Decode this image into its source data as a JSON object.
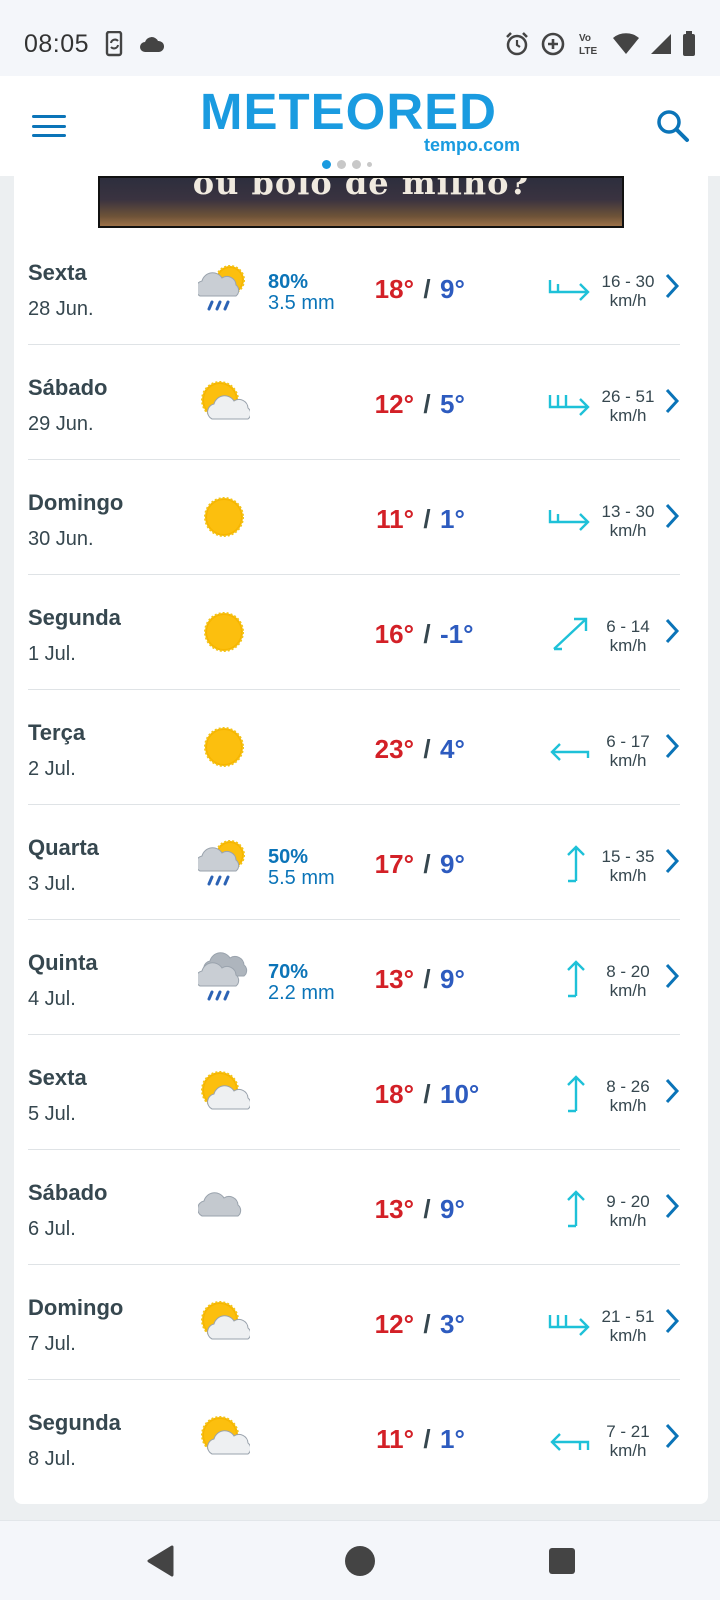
{
  "status_bar": {
    "time": "08:05",
    "icons": [
      "phone-sync-icon",
      "cloud-icon",
      "alarm-icon",
      "data-saver-icon",
      "volte-icon",
      "wifi-icon",
      "signal-icon",
      "battery-icon"
    ],
    "volte_label": "Vo LTE"
  },
  "header": {
    "logo_main": "METEORED",
    "logo_sub": "tempo.com"
  },
  "banner": {
    "text": "ou bolo de milho?"
  },
  "forecast": [
    {
      "day": "Sexta",
      "date": "28 Jun.",
      "icon": "rain-sun-icon",
      "rain_prob": "80%",
      "rain_mm": "3.5 mm",
      "tmax": "18°",
      "tmin": "9°",
      "wind": "16 - 30",
      "wind_unit": "km/h",
      "wind_dir": "east-gusty-icon"
    },
    {
      "day": "Sábado",
      "date": "29 Jun.",
      "icon": "sun-cloud-icon",
      "rain_prob": "",
      "rain_mm": "",
      "tmax": "12°",
      "tmin": "5°",
      "wind": "26 - 51",
      "wind_unit": "km/h",
      "wind_dir": "east-strong-icon"
    },
    {
      "day": "Domingo",
      "date": "30 Jun.",
      "icon": "sun-icon",
      "rain_prob": "",
      "rain_mm": "",
      "tmax": "11°",
      "tmin": "1°",
      "wind": "13 - 30",
      "wind_unit": "km/h",
      "wind_dir": "east-gusty-icon"
    },
    {
      "day": "Segunda",
      "date": "1 Jul.",
      "icon": "sun-icon",
      "rain_prob": "",
      "rain_mm": "",
      "tmax": "16°",
      "tmin": "-1°",
      "wind": "6 - 14",
      "wind_unit": "km/h",
      "wind_dir": "northeast-icon"
    },
    {
      "day": "Terça",
      "date": "2 Jul.",
      "icon": "sun-icon",
      "rain_prob": "",
      "rain_mm": "",
      "tmax": "23°",
      "tmin": "4°",
      "wind": "6 - 17",
      "wind_unit": "km/h",
      "wind_dir": "west-icon"
    },
    {
      "day": "Quarta",
      "date": "3 Jul.",
      "icon": "rain-sun-icon",
      "rain_prob": "50%",
      "rain_mm": "5.5 mm",
      "tmax": "17°",
      "tmin": "9°",
      "wind": "15 - 35",
      "wind_unit": "km/h",
      "wind_dir": "north-icon"
    },
    {
      "day": "Quinta",
      "date": "4 Jul.",
      "icon": "rain-cloud-icon",
      "rain_prob": "70%",
      "rain_mm": "2.2 mm",
      "tmax": "13°",
      "tmin": "9°",
      "wind": "8 - 20",
      "wind_unit": "km/h",
      "wind_dir": "north-icon"
    },
    {
      "day": "Sexta",
      "date": "5 Jul.",
      "icon": "sun-cloud-icon",
      "rain_prob": "",
      "rain_mm": "",
      "tmax": "18°",
      "tmin": "10°",
      "wind": "8 - 26",
      "wind_unit": "km/h",
      "wind_dir": "north-icon"
    },
    {
      "day": "Sábado",
      "date": "6 Jul.",
      "icon": "cloud-icon",
      "rain_prob": "",
      "rain_mm": "",
      "tmax": "13°",
      "tmin": "9°",
      "wind": "9 - 20",
      "wind_unit": "km/h",
      "wind_dir": "north-icon"
    },
    {
      "day": "Domingo",
      "date": "7 Jul.",
      "icon": "sun-cloud-icon",
      "rain_prob": "",
      "rain_mm": "",
      "tmax": "12°",
      "tmin": "3°",
      "wind": "21 - 51",
      "wind_unit": "km/h",
      "wind_dir": "east-strong-icon"
    },
    {
      "day": "Segunda",
      "date": "8 Jul.",
      "icon": "sun-cloud-icon",
      "rain_prob": "",
      "rain_mm": "",
      "tmax": "11°",
      "tmin": "1°",
      "wind": "7 - 21",
      "wind_unit": "km/h",
      "wind_dir": "west-gusty-icon"
    }
  ],
  "colors": {
    "brand": "#1a9be0",
    "temp_max": "#d32027",
    "temp_min": "#2d5bbf",
    "wind": "#1ec1d8",
    "link": "#0b74b8"
  },
  "nav_bar": {
    "buttons": [
      "back-button",
      "home-button",
      "recents-button"
    ]
  }
}
